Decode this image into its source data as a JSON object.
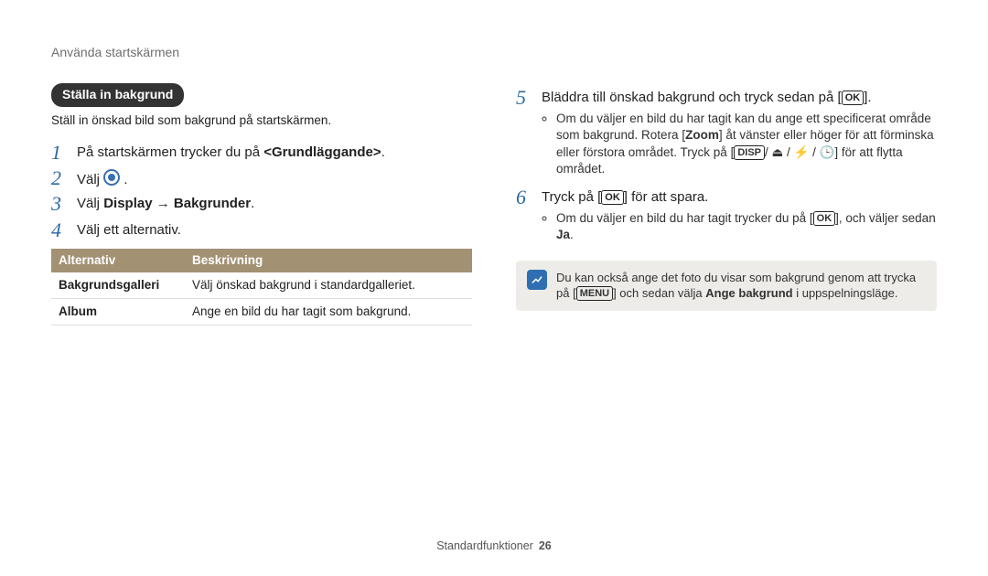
{
  "header": "Använda startskärmen",
  "pill": "Ställa in bakgrund",
  "intro": "Ställ in önskad bild som bakgrund på startskärmen.",
  "left_steps": {
    "s1_a": "På startskärmen trycker du på ",
    "s1_b": "<Grundläggande>",
    "s1_c": ".",
    "s2": "Välj ",
    "s3_a": "Välj ",
    "s3_b": "Display",
    "s3_arrow": " → ",
    "s3_c": "Bakgrunder",
    "s3_d": ".",
    "s4": "Välj ett alternativ."
  },
  "table": {
    "h1": "Alternativ",
    "h2": "Beskrivning",
    "r1c1": "Bakgrundsgalleri",
    "r1c2": "Välj önskad bakgrund i standardgalleriet.",
    "r2c1": "Album",
    "r2c2": "Ange en bild du har tagit som bakgrund."
  },
  "right_steps": {
    "s5_a": "Bläddra till önskad bakgrund och tryck sedan på [",
    "s5_b": "].",
    "s5_bul_a": "Om du väljer en bild du har tagit kan du ange ett specificerat område som bakgrund. Rotera [",
    "s5_bul_zoom": "Zoom",
    "s5_bul_b": "] åt vänster eller höger för att förminska eller förstora området. Tryck på [",
    "s5_bul_c": "] för att flytta området.",
    "s6_a": "Tryck på [",
    "s6_b": "] för att spara.",
    "s6_bul_a": "Om du väljer en bild du har tagit trycker du på [",
    "s6_bul_b": "], och väljer sedan ",
    "s6_bul_ja": "Ja",
    "s6_bul_c": "."
  },
  "note_a": "Du kan också ange det foto du visar som bakgrund genom att trycka på [",
  "note_b": "] och sedan välja ",
  "note_bold": "Ange bakgrund",
  "note_c": " i uppspelningsläge.",
  "icons": {
    "ok": "OK",
    "disp": "DISP",
    "menu": "MENU",
    "nav_glyphs": "/ ⏏ / ⚡ / 🕒"
  },
  "footer": {
    "label": "Standardfunktioner",
    "page": "26"
  }
}
